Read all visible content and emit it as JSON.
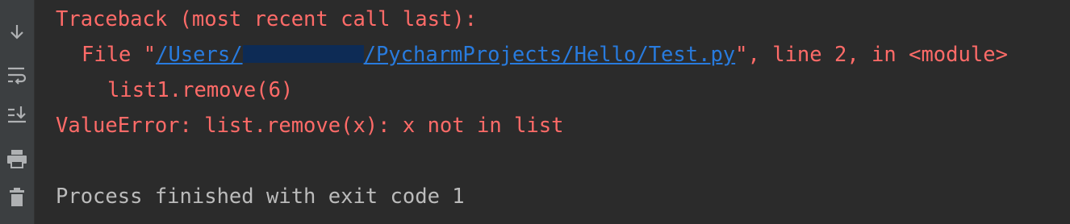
{
  "toolbar": {
    "tools": [
      {
        "icon": "scroll-to-end-icon"
      },
      {
        "icon": "soft-wrap-icon"
      },
      {
        "icon": "scroll-down-icon"
      },
      {
        "icon": "print-icon"
      },
      {
        "icon": "trash-icon"
      }
    ]
  },
  "console": {
    "colors": {
      "background": "#2b2b2b",
      "error": "#ff6b68",
      "link": "#287bde",
      "text": "#bbbbbb",
      "gutter": "#3c3f41"
    },
    "traceback_header": "Traceback (most recent call last):",
    "file_prefix": "File \"",
    "file_path_start": "/Users/",
    "file_path_end": "/PycharmProjects/Hello/Test.py",
    "file_suffix": "\", line 2, in <module>",
    "code_line": "list1.remove(6)",
    "error_message": "ValueError: list.remove(x): x not in list",
    "process_message": "Process finished with exit code 1"
  }
}
